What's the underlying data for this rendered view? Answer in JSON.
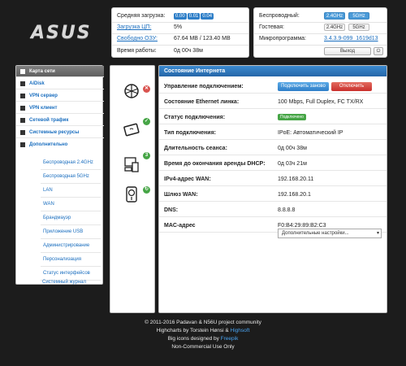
{
  "logo": "ASUS",
  "system": {
    "load_label": "Средняя загрузка:",
    "load_values": [
      "0.00",
      "0.01",
      "0.04"
    ],
    "cpu_label": "Загрузка ЦП:",
    "cpu_value": "5%",
    "ram_label": "Свободно ОЗУ:",
    "ram_value": "67.64 MB / 123.40 MB",
    "uptime_label": "Время работы:",
    "uptime_value": "0д 00ч 38м"
  },
  "wireless": {
    "wireless_label": "Беспроводный:",
    "wireless_24": "2.4GHz",
    "wireless_5": "5GHz",
    "guest_label": "Гостевая:",
    "guest_24": "2.4GHz",
    "guest_5": "5GHz",
    "firmware_label": "Микропрограмма:",
    "firmware_value": "3.4.3.9-099_1619d13",
    "logout_label": "Выход",
    "power_icon": "⏻"
  },
  "sidebar": {
    "items": [
      {
        "label": "Карта сети",
        "active": true
      },
      {
        "label": "AiDisk"
      },
      {
        "label": "VPN сервер"
      },
      {
        "label": "VPN клиент"
      },
      {
        "label": "Сетевой трафик"
      },
      {
        "label": "Системные ресурсы"
      },
      {
        "label": "Дополнительно"
      }
    ],
    "subitems": [
      "Беспроводная 2.4GHz",
      "Беспроводная 5GHz",
      "LAN",
      "WAN",
      "Брандмауэр",
      "Приложение USB",
      "Администрирование",
      "Персонализация",
      "Статус интерфейсов",
      "Системный журнал"
    ]
  },
  "main": {
    "title": "Состояние Интернета",
    "rows": [
      {
        "label": "Управление подключением:"
      },
      {
        "label": "Состояние Ethernet линка:",
        "value": "100 Mbps, Full Duplex, FC TX/RX"
      },
      {
        "label": "Статус подключения:"
      },
      {
        "label": "Тип подключения:",
        "value": "IPoE: Автоматический IP"
      },
      {
        "label": "Длительность сеанса:",
        "value": "0д 00ч 38м"
      },
      {
        "label": "Время до окончания аренды DHCP:",
        "value": "0д 03ч 21м"
      },
      {
        "label": "IPv4-адрес WAN:",
        "value": "192.168.20.11"
      },
      {
        "label": "Шлюз WAN:",
        "value": "192.168.20.1"
      },
      {
        "label": "DNS:",
        "value": "8.8.8.8"
      },
      {
        "label": "MAC-адрес",
        "value": "F0:B4:29:89:B2:C3"
      }
    ],
    "reconnect_label": "Подключить заново",
    "disconnect_label": "Отключить",
    "status_badge": "Подключено",
    "advanced_select": "Дополнительные настройки...",
    "chevron_icon": "▾"
  },
  "status_icons": {
    "x": "✕",
    "check": "✓",
    "num": "3",
    "refresh": "↻"
  },
  "footer": {
    "line1": "© 2011-2016 Padavan & N56U project community",
    "line2_pre": "Highcharts by Torstein Hønsi & ",
    "line2_link": "Highsoft",
    "line3_pre": "Big icons designed by ",
    "line3_link": "Freepik",
    "line4": "Non-Commercial Use Only"
  }
}
